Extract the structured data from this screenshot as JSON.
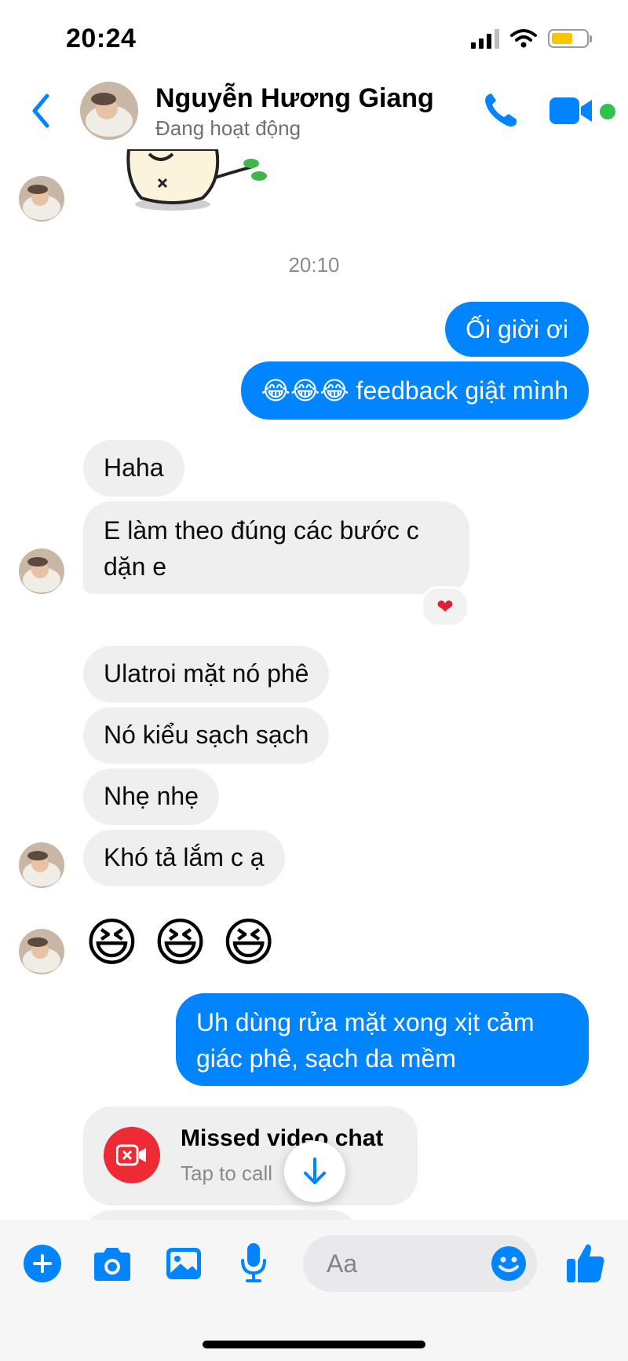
{
  "status_bar": {
    "time": "20:24"
  },
  "header": {
    "contact_name": "Nguyễn Hương Giang",
    "contact_status": "Đang hoạt động"
  },
  "timestamp": "20:10",
  "messages": [
    {
      "side": "outgoing",
      "text": "Ối giời ơi"
    },
    {
      "side": "outgoing",
      "text": "😂😂😂 feedback giật mình"
    },
    {
      "side": "incoming",
      "text": "Haha"
    },
    {
      "side": "incoming",
      "line1": "E làm theo đúng các bước c",
      "line2": "dặn e",
      "reaction": "❤"
    },
    {
      "side": "incoming",
      "text": "Ulatroi mặt nó phê"
    },
    {
      "side": "incoming",
      "text": "Nó kiểu sạch sạch"
    },
    {
      "side": "incoming",
      "text": "Nhẹ nhẹ"
    },
    {
      "side": "incoming",
      "text": "Khó tả lắm c ạ"
    },
    {
      "side": "incoming",
      "text": "😆 😆 😆"
    },
    {
      "side": "outgoing",
      "line1": "Uh dùng rửa mặt xong xịt cảm",
      "line2": "giác phê, sạch da mềm"
    }
  ],
  "missed_call": {
    "title": "Missed video chat",
    "subtitle": "Tap to call"
  },
  "composer": {
    "placeholder": "Aa"
  },
  "colors": {
    "accent": "#0084ff",
    "incoming_bubble": "#efeff0",
    "missed_red": "#ee2b34",
    "active_dot": "#31c24d"
  },
  "icons": [
    "back-icon",
    "phone-icon",
    "video-icon",
    "plus-icon",
    "camera-icon",
    "gallery-icon",
    "mic-icon",
    "emoji-icon",
    "thumbs-up-icon",
    "scroll-down-icon",
    "missed-video-icon"
  ]
}
